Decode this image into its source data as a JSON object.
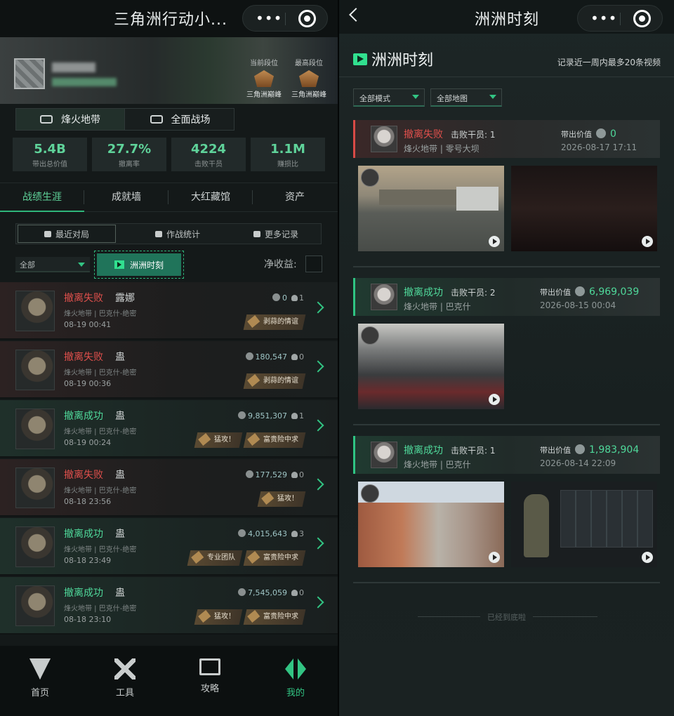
{
  "left": {
    "title": "三角洲行动小...",
    "rank_current_label": "当前段位",
    "rank_current_name": "三角洲巅峰",
    "rank_highest_label": "最高段位",
    "rank_highest_name": "三角洲巅峰",
    "mode_tabs": [
      "烽火地带",
      "全面战场"
    ],
    "stats": [
      {
        "value": "5.4B",
        "label": "带出总价值"
      },
      {
        "value": "27.7%",
        "label": "撤离率"
      },
      {
        "value": "4224",
        "label": "击败干员"
      },
      {
        "value": "1.1M",
        "label": "赚损比"
      }
    ],
    "nav_tabs": [
      "战绩生涯",
      "成就墙",
      "大红藏馆",
      "资产"
    ],
    "sub_tabs": [
      "最近对局",
      "作战统计",
      "更多记录"
    ],
    "filter": "全部",
    "moments_button": "洲洲时刻",
    "net_label": "净收益:",
    "matches": [
      {
        "result": "撤离失败",
        "status": "fail",
        "operator": "露娜",
        "map": "烽火地带 | 巴克什-绝密",
        "time": "08-19 00:41",
        "value": "0",
        "kills": "1",
        "badges": [
          "剥蒜的情谊"
        ]
      },
      {
        "result": "撤离失败",
        "status": "fail",
        "operator": "蛊",
        "map": "烽火地带 | 巴克什-绝密",
        "time": "08-19 00:36",
        "value": "180,547",
        "kills": "0",
        "badges": [
          "剥蒜的情谊"
        ]
      },
      {
        "result": "撤离成功",
        "status": "ok",
        "operator": "蛊",
        "map": "烽火地带 | 巴克什-绝密",
        "time": "08-19 00:24",
        "value": "9,851,307",
        "kills": "1",
        "badges": [
          "猛攻！",
          "富贵险中求"
        ]
      },
      {
        "result": "撤离失败",
        "status": "fail",
        "operator": "蛊",
        "map": "烽火地带 | 巴克什-绝密",
        "time": "08-18 23:56",
        "value": "177,529",
        "kills": "0",
        "badges": [
          "猛攻！"
        ]
      },
      {
        "result": "撤离成功",
        "status": "ok",
        "operator": "蛊",
        "map": "烽火地带 | 巴克什-绝密",
        "time": "08-18 23:49",
        "value": "4,015,643",
        "kills": "3",
        "badges": [
          "专业团队",
          "富贵险中求"
        ]
      },
      {
        "result": "撤离成功",
        "status": "ok",
        "operator": "蛊",
        "map": "烽火地带 | 巴克什-绝密",
        "time": "08-18 23:10",
        "value": "7,545,059",
        "kills": "0",
        "badges": [
          "猛攻！",
          "富贵险中求"
        ]
      }
    ],
    "bottom_nav": [
      "首页",
      "工具",
      "攻略",
      "我的"
    ]
  },
  "right": {
    "title": "洲洲时刻",
    "section_title": "洲洲时刻",
    "section_note": "记录近一周内最多20条视频",
    "filters": [
      "全部模式",
      "全部地图"
    ],
    "kills_prefix": "击败干员: ",
    "value_label": "带出价值",
    "cards": [
      {
        "result": "撤离失败",
        "status": "fail",
        "kills": "1",
        "map": "烽火地带 | 零号大坝",
        "value": "0",
        "date": "2026-08-17 17:11"
      },
      {
        "result": "撤离成功",
        "status": "ok",
        "kills": "2",
        "map": "烽火地带 | 巴克什",
        "value": "6,969,039",
        "date": "2026-08-15 00:04"
      },
      {
        "result": "撤离成功",
        "status": "ok",
        "kills": "1",
        "map": "烽火地带 | 巴克什",
        "value": "1,983,904",
        "date": "2026-08-14 22:09"
      }
    ],
    "end_text": "已经到底啦"
  },
  "colors": {
    "accent": "#32c483",
    "fail": "#e0504c",
    "success": "#4fd89a",
    "background": "#141919"
  }
}
